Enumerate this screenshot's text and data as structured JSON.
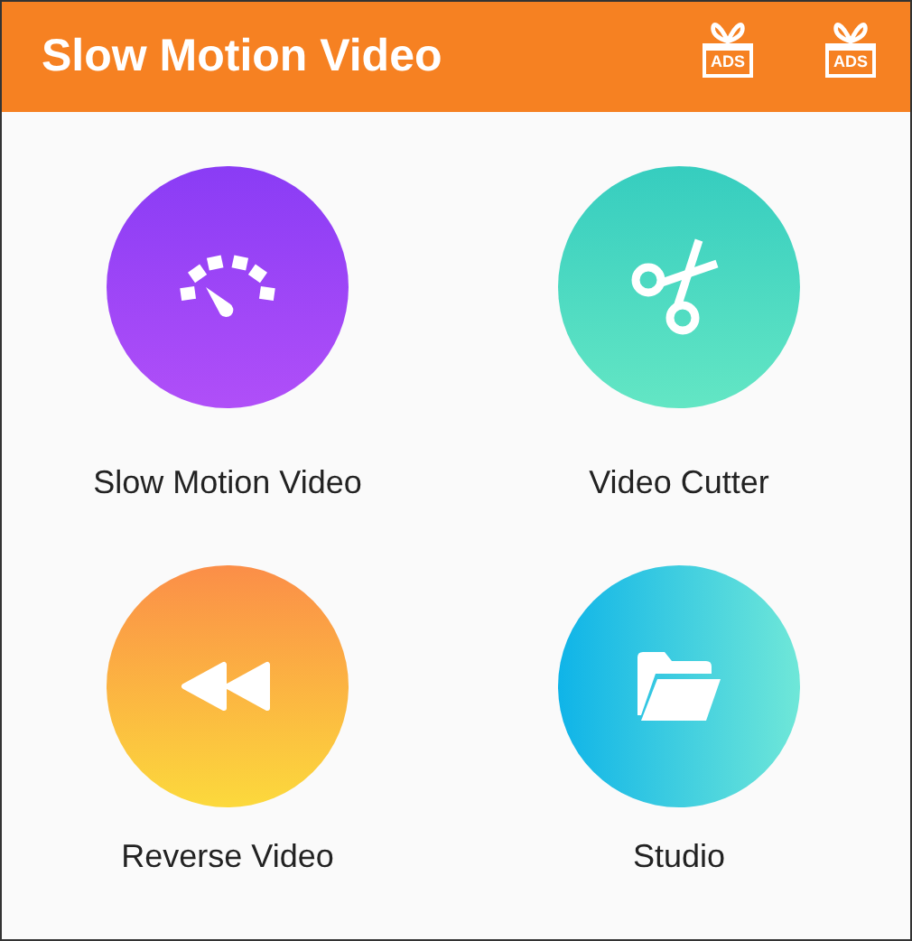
{
  "app_bar": {
    "title": "Slow Motion Video",
    "gift_badges": [
      "ADS",
      "ADS"
    ]
  },
  "tiles": [
    {
      "kind": "speedometer",
      "label": "Slow Motion Video"
    },
    {
      "kind": "scissors",
      "label": "Video Cutter"
    },
    {
      "kind": "rewind",
      "label": "Reverse Video"
    },
    {
      "kind": "folder",
      "label": "Studio"
    }
  ]
}
